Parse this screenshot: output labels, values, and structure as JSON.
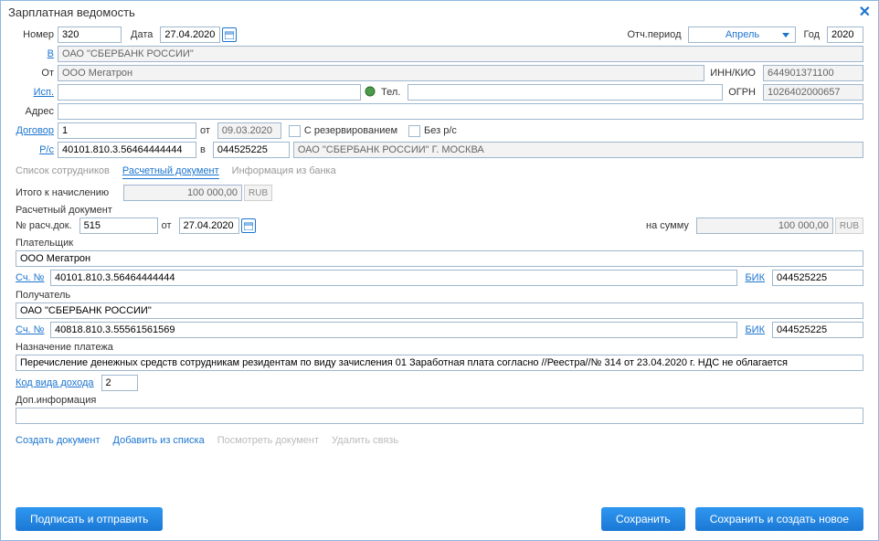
{
  "window": {
    "title": "Зарплатная ведомость",
    "close": "✕"
  },
  "header": {
    "number_label": "Номер",
    "number_value": "320",
    "date_label": "Дата",
    "date_value": "27.04.2020",
    "period_label": "Отч.период",
    "period_value": "Апрель",
    "year_label": "Год",
    "year_value": "2020"
  },
  "rows": {
    "v_label": "В",
    "v_value": "ОАО \"СБЕРБАНК РОССИИ\"",
    "ot_label": "От",
    "ot_value": "ООО Мегатрон",
    "inn_label": "ИНН/КИО",
    "inn_value": "644901371100",
    "isp_label": "Исп.",
    "isp_value": "",
    "tel_label": "Тел.",
    "tel_value": "",
    "ogrn_label": "ОГРН",
    "ogrn_value": "1026402000657",
    "address_label": "Адрес",
    "address_value": "",
    "dogovor_label": "Договор",
    "dogovor_value": "1",
    "dogovor_ot_label": "от",
    "dogovor_ot_value": "09.03.2020",
    "reserve_label": "С резервированием",
    "bez_rs_label": "Без р/с",
    "rs_label": "Р/с",
    "rs_value": "40101.810.3.56464444444",
    "rs_v_label": "в",
    "bik_value": "044525225",
    "bank_name_value": "ОАО \"СБЕРБАНК РОССИИ\" Г. МОСКВА"
  },
  "tabs": {
    "t1": "Список сотрудников",
    "t2": "Расчетный документ",
    "t3": "Информация из банка"
  },
  "calc": {
    "total_label": "Итого к начислению",
    "total_value": "100 000,00",
    "currency": "RUB",
    "section_doc": "Расчетный документ",
    "doc_no_label": "№ расч.док.",
    "doc_no_value": "515",
    "doc_ot_label": "от",
    "doc_date_value": "27.04.2020",
    "sum_label": "на сумму",
    "sum_value": "100 000,00",
    "payer_section": "Плательщик",
    "payer_name": "ООО Мегатрон",
    "acc_label": "Сч. №",
    "payer_acc": "40101.810.3.56464444444",
    "bik_label": "БИК",
    "payer_bik": "044525225",
    "payee_section": "Получатель",
    "payee_name": "ОАО \"СБЕРБАНК РОССИИ\"",
    "payee_acc": "40818.810.3.55561561569",
    "payee_bik": "044525225",
    "purpose_section": "Назначение платежа",
    "purpose_value": "Перечисление денежных средств сотрудникам резидентам по виду зачисления 01 Заработная плата согласно //Реестра//№ 314 от 23.04.2020 г. НДС не облагается",
    "income_code_label": "Код вида дохода",
    "income_code_value": "2",
    "extra_section": "Доп.информация",
    "extra_value": ""
  },
  "links": {
    "create": "Создать документ",
    "add": "Добавить из списка",
    "view": "Посмотреть документ",
    "del": "Удалить связь"
  },
  "buttons": {
    "sign_send": "Подписать и отправить",
    "save": "Сохранить",
    "save_new": "Сохранить и создать новое"
  }
}
